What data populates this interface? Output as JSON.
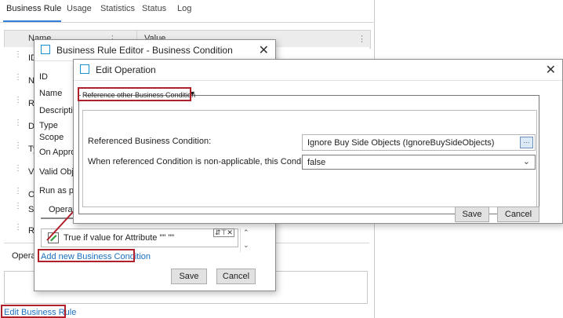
{
  "tabs": [
    {
      "label": "Business Rule"
    },
    {
      "label": "Usage"
    },
    {
      "label": "Statistics"
    },
    {
      "label": "Status"
    },
    {
      "label": "Log"
    }
  ],
  "grid": {
    "col_name": "Name",
    "col_value": "Value",
    "rows": [
      "ID",
      "Na",
      "Re",
      "De",
      "Ty",
      "Va",
      "O",
      "Sc",
      "Ru"
    ]
  },
  "operations_tab_label": "Operat",
  "edit_business_rule_link": "Edit Business Rule",
  "bc_editor": {
    "title": "Business Rule Editor - Business Condition",
    "labels": [
      "ID",
      "Name",
      "Description",
      "Type",
      "Scope",
      "On Approv",
      "Valid Objec",
      "Run as priv"
    ],
    "operations_label": "Operati",
    "operation_item": "True if value for Attribute \"\" \"\"",
    "add_link": "Add new Business Condition",
    "save": "Save",
    "cancel": "Cancel"
  },
  "edit_operation": {
    "title": "Edit Operation",
    "dropdown": "Reference other Business Condition",
    "ref_label": "Referenced Business Condition:",
    "ref_value": "Ignore Buy Side Objects (IgnoreBuySideObjects)",
    "nonapp_label": "When referenced Condition is non-applicable, this Condition will be:",
    "nonapp_value": "false",
    "save": "Save",
    "cancel": "Cancel"
  },
  "colors": {
    "highlight": "#b0202a",
    "accent": "#1a8fd0",
    "link": "#1a6fbf"
  }
}
